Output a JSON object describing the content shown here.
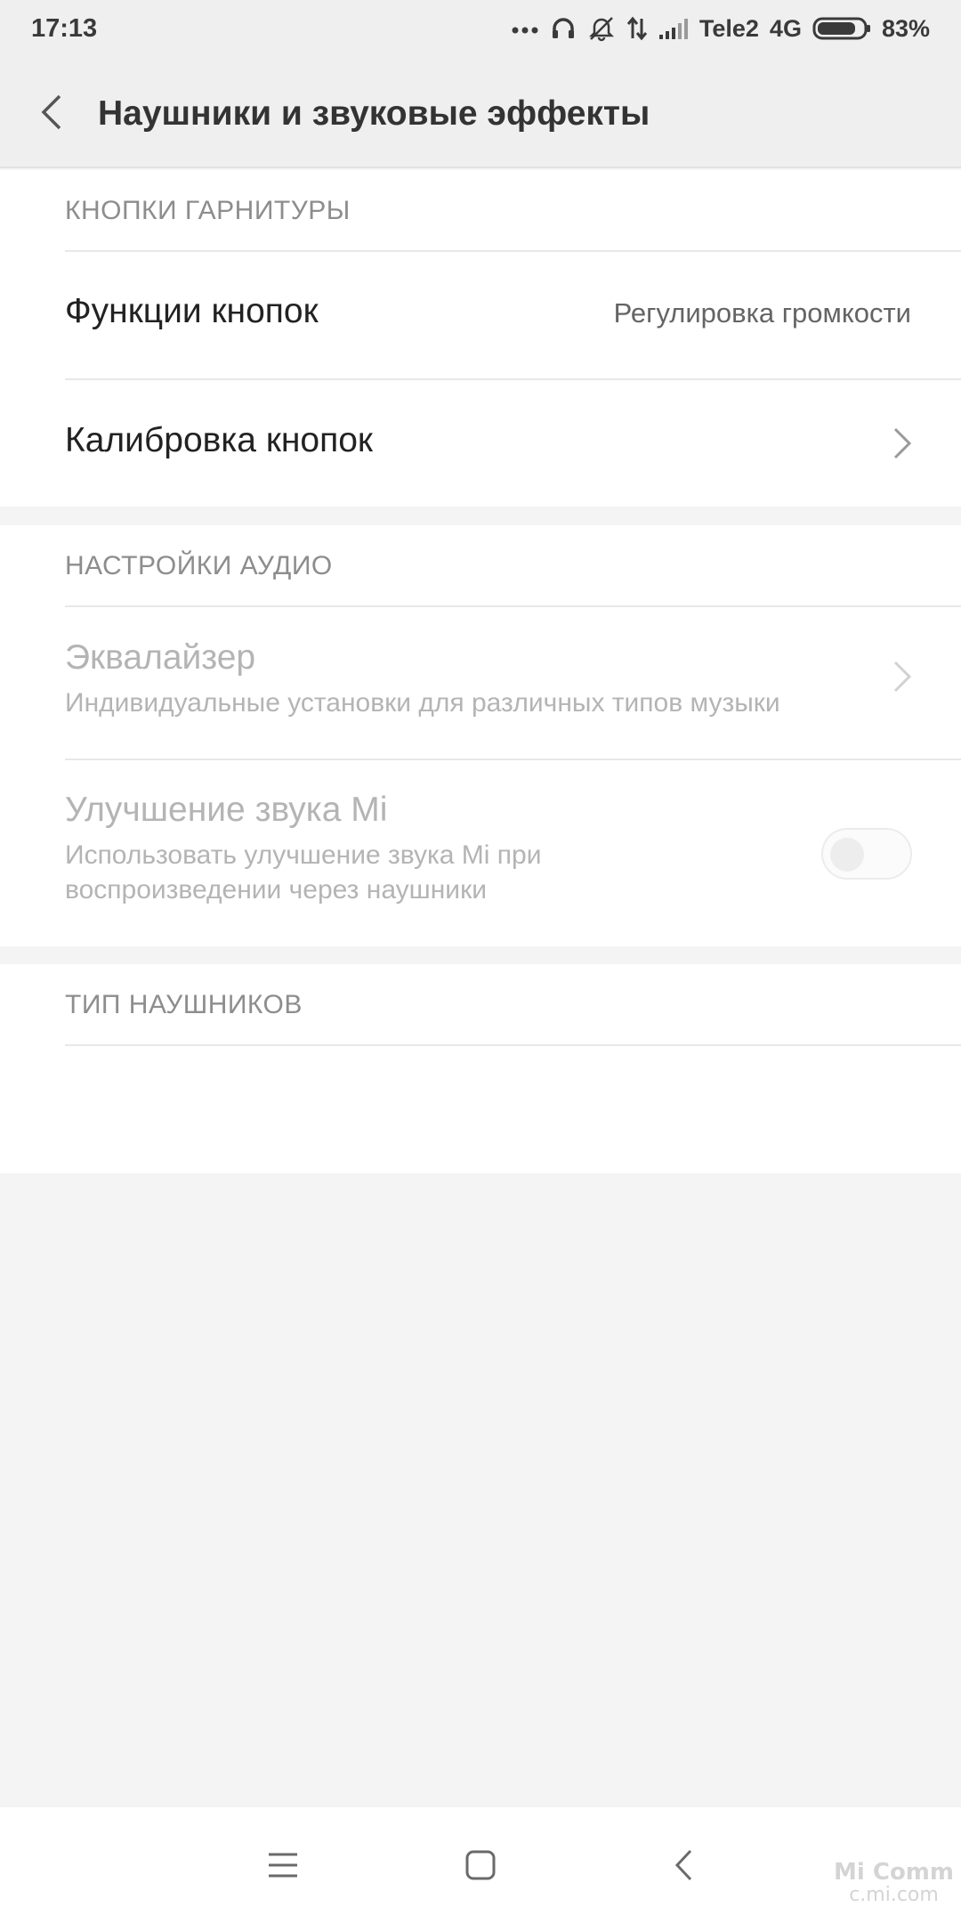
{
  "status_bar": {
    "time": "17:13",
    "carrier": "Tele2",
    "network": "4G",
    "battery": "83%",
    "battery_level": 0.83,
    "icons": [
      "more-dots-icon",
      "headphones-icon",
      "muted-bell-icon",
      "data-arrows-icon",
      "signal-icon",
      "battery-icon"
    ]
  },
  "header": {
    "title": "Наушники и звуковые эффекты",
    "back_icon": "chevron-left-icon"
  },
  "sections": {
    "headset_buttons": {
      "header": "КНОПКИ ГАРНИТУРЫ",
      "button_functions": {
        "title": "Функции кнопок",
        "value": "Регулировка громкости"
      },
      "button_calibration": {
        "title": "Калибровка кнопок"
      }
    },
    "audio_settings": {
      "header": "НАСТРОЙКИ АУДИО",
      "equalizer": {
        "title": "Эквалайзер",
        "subtitle": "Индивидуальные установки для различных типов музыки"
      },
      "mi_sound": {
        "title": "Улучшение звука Mi",
        "subtitle_line1": "Использовать улучшение звука Mi при",
        "subtitle_line2": "воспроизведении через наушники",
        "enabled": false
      }
    },
    "headphone_type": {
      "header": "ТИП НАУШНИКОВ"
    }
  },
  "nav_bar": {
    "buttons": [
      "menu-icon",
      "home-icon",
      "back-icon"
    ]
  },
  "watermark": {
    "line1": "Mi Comm",
    "line2": "c.mi.com"
  },
  "colors": {
    "background": "#f4f4f4",
    "card": "#ffffff",
    "header_bg": "#efefef",
    "section_header": "#8d8d8d",
    "disabled_text": "#b4b4b4"
  }
}
